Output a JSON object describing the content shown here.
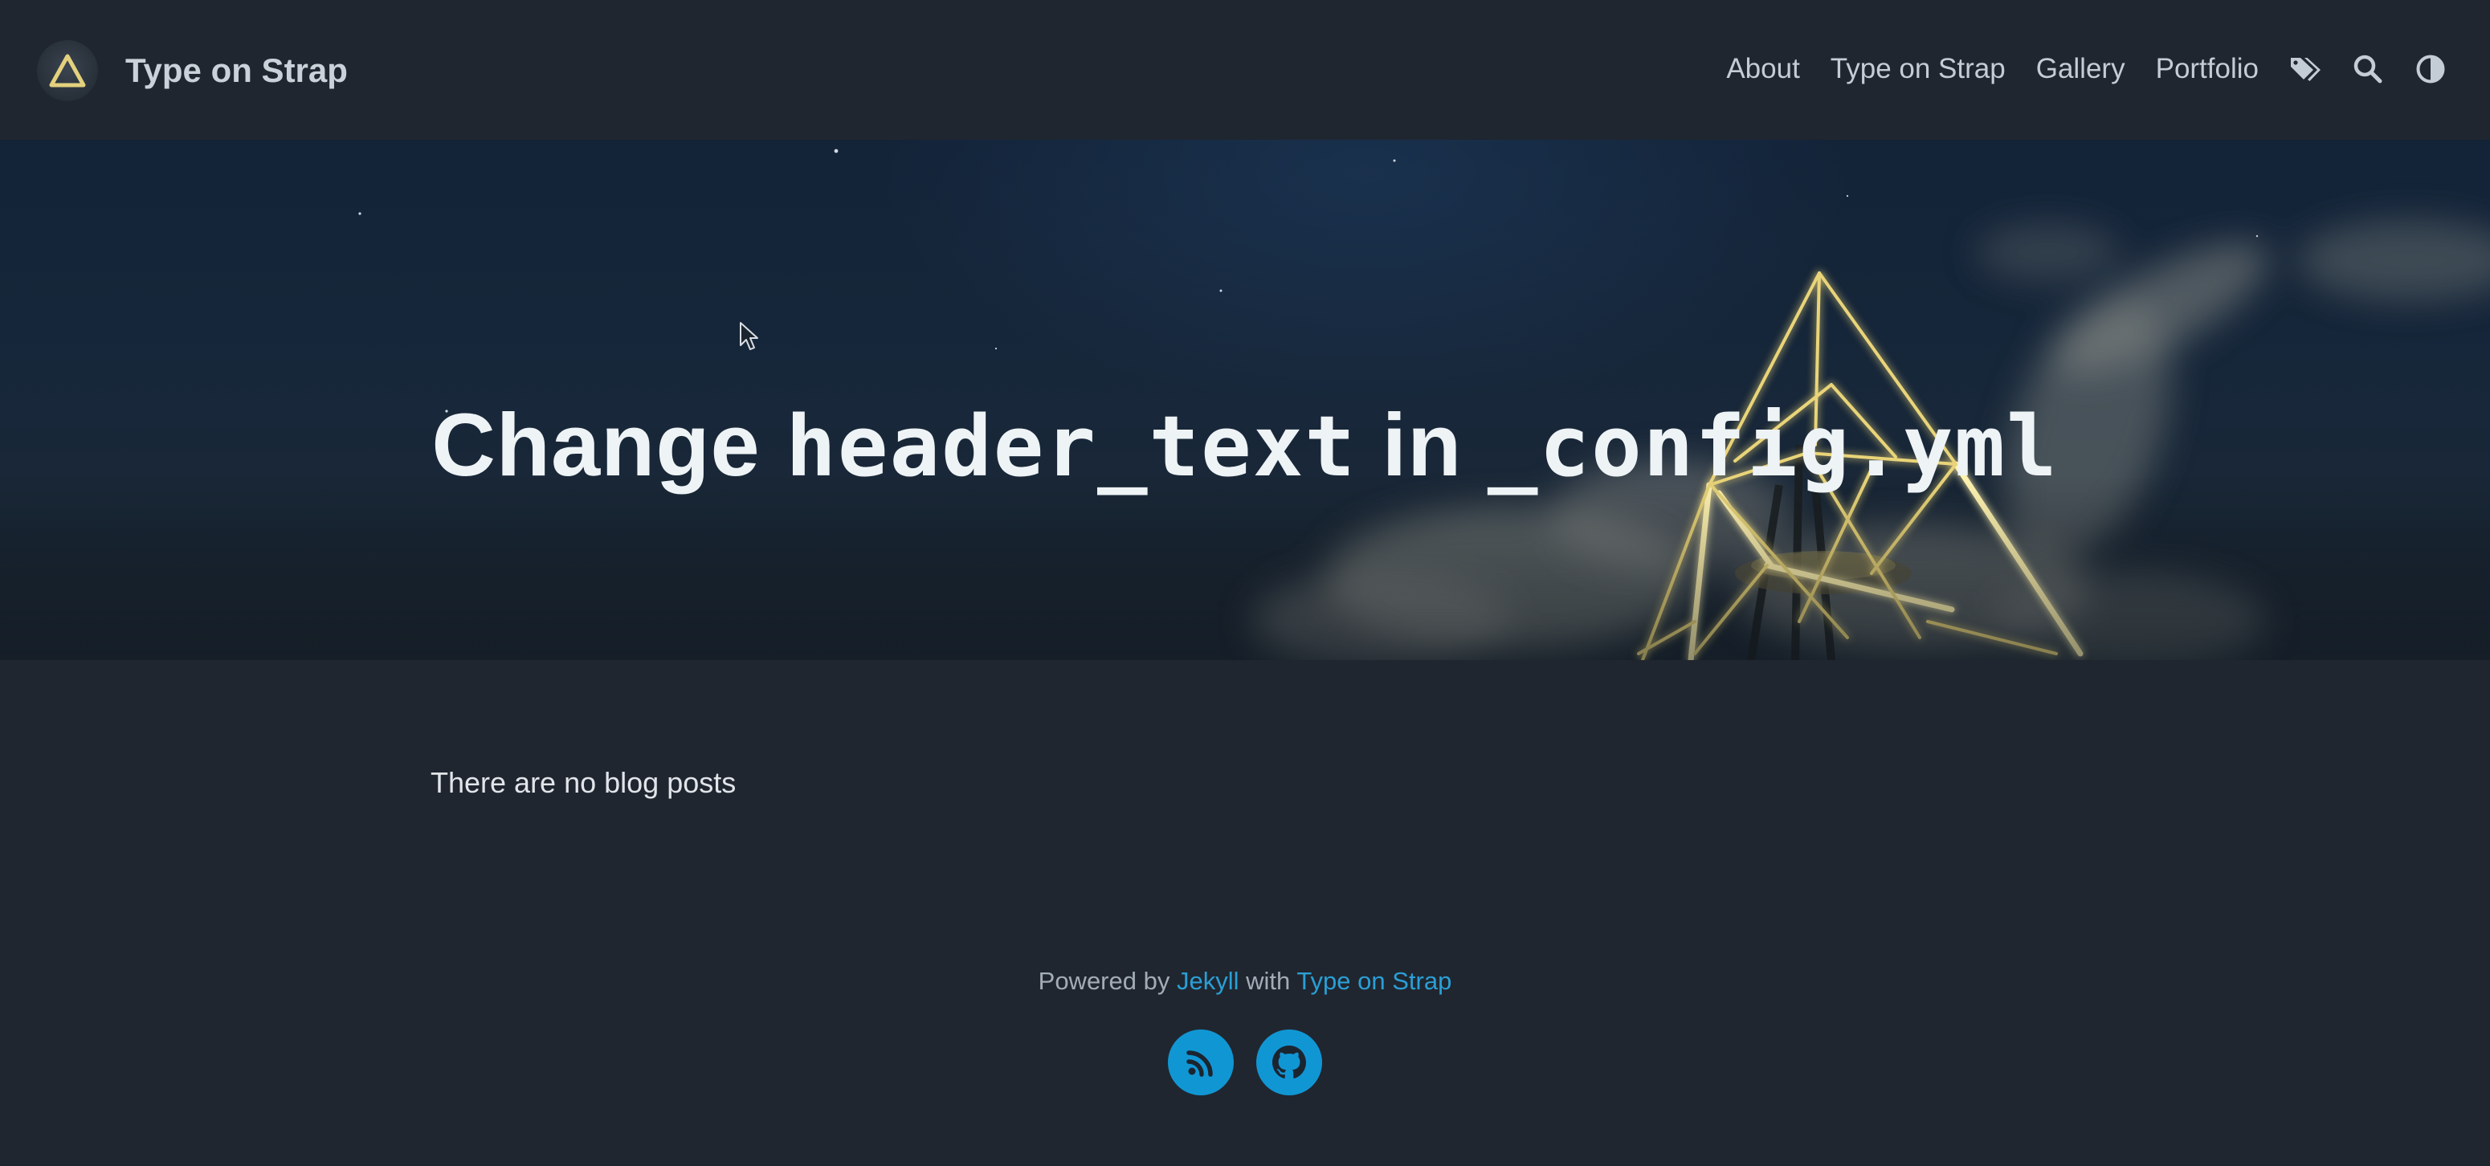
{
  "site": {
    "title": "Type on Strap",
    "logo_icon": "triangle-logo-icon"
  },
  "nav": {
    "links": [
      {
        "label": "About"
      },
      {
        "label": "Type on Strap"
      },
      {
        "label": "Gallery"
      },
      {
        "label": "Portfolio"
      }
    ],
    "icons": [
      "tags-icon",
      "search-icon",
      "theme-toggle-icon"
    ]
  },
  "hero": {
    "title_prefix": "Change",
    "title_code_1": "header_text",
    "title_mid": "in",
    "title_code_2": "_config.yml"
  },
  "main": {
    "message": "There are no blog posts"
  },
  "footer": {
    "powered_by": "Powered by",
    "jekyll_link": "Jekyll",
    "with": "with",
    "theme_link": "Type on Strap",
    "social": [
      "rss-icon",
      "github-icon"
    ]
  },
  "colors": {
    "background": "#20262f",
    "accent": "#2a9fd6",
    "social_button": "#1196d4",
    "logo_triangle": "#e4d17e"
  }
}
